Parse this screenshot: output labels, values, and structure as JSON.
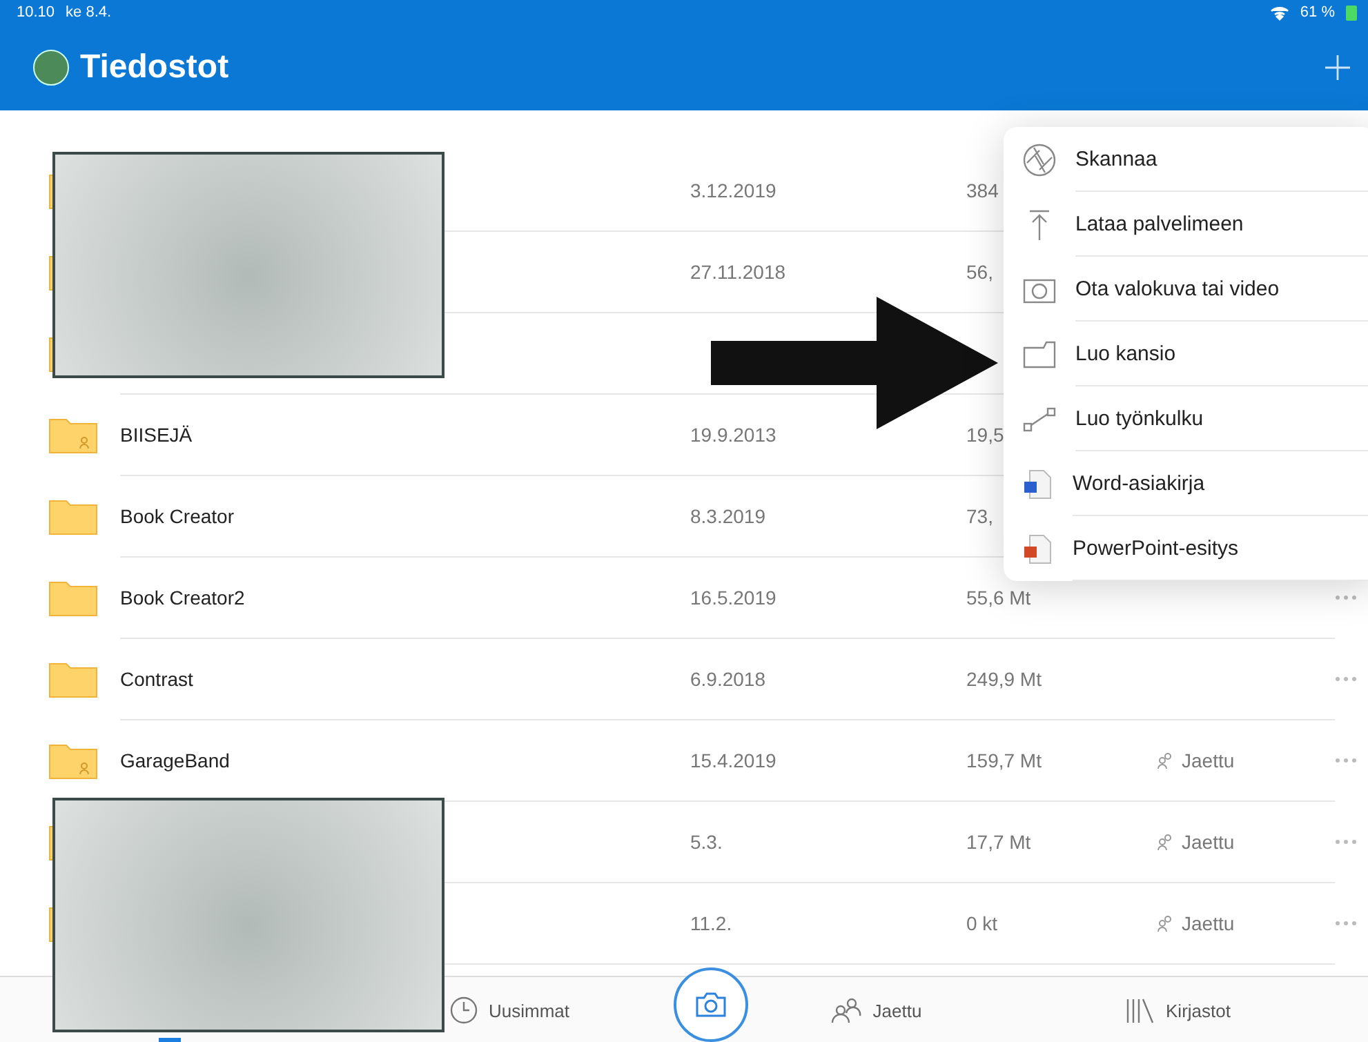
{
  "status_bar": {
    "time": "10.10",
    "date": "ke 8.4.",
    "battery": "61 %"
  },
  "header": {
    "title": "Tiedostot"
  },
  "rows": [
    {
      "date": "3.12.2019",
      "size": "384"
    },
    {
      "date": "27.11.2018",
      "size": "56,"
    },
    {},
    {
      "folder_shared": true,
      "name": "BIISEJÄ",
      "date": "19.9.2013",
      "size": "19,5"
    },
    {
      "folder_shared": false,
      "name": "Book Creator",
      "date": "8.3.2019",
      "size": "73,"
    },
    {
      "folder_shared": false,
      "name": "Book Creator2",
      "date": "16.5.2019",
      "size": "55,6 Mt"
    },
    {
      "folder_shared": false,
      "name": "Contrast",
      "date": "6.9.2018",
      "size": "249,9 Mt"
    },
    {
      "folder_shared": true,
      "name": "GarageBand",
      "date": "15.4.2019",
      "size": "159,7 Mt",
      "shared": "Jaettu"
    },
    {
      "date": "5.3.",
      "size": "17,7 Mt",
      "shared": "Jaettu"
    },
    {
      "date": "11.2.",
      "size": "0 kt",
      "shared": "Jaettu"
    }
  ],
  "menu": [
    {
      "kind": "scan",
      "label": "Skannaa"
    },
    {
      "kind": "upload",
      "label": "Lataa palvelimeen"
    },
    {
      "kind": "camera",
      "label": "Ota valokuva tai video"
    },
    {
      "kind": "folder",
      "label": "Luo kansio"
    },
    {
      "kind": "flow",
      "label": "Luo työnkulku"
    },
    {
      "kind": "word",
      "label": "Word-asiakirja"
    },
    {
      "kind": "powerpoint",
      "label": "PowerPoint-esitys"
    }
  ],
  "tabs": [
    {
      "kind": "files",
      "selected": true
    },
    {
      "kind": "recent",
      "label": "Uusimmat",
      "selected": false
    },
    {
      "kind": "camera",
      "selected": false
    },
    {
      "kind": "shared",
      "label": "Jaettu",
      "selected": false
    },
    {
      "kind": "libraries",
      "label": "Kirjastot",
      "selected": false
    }
  ]
}
